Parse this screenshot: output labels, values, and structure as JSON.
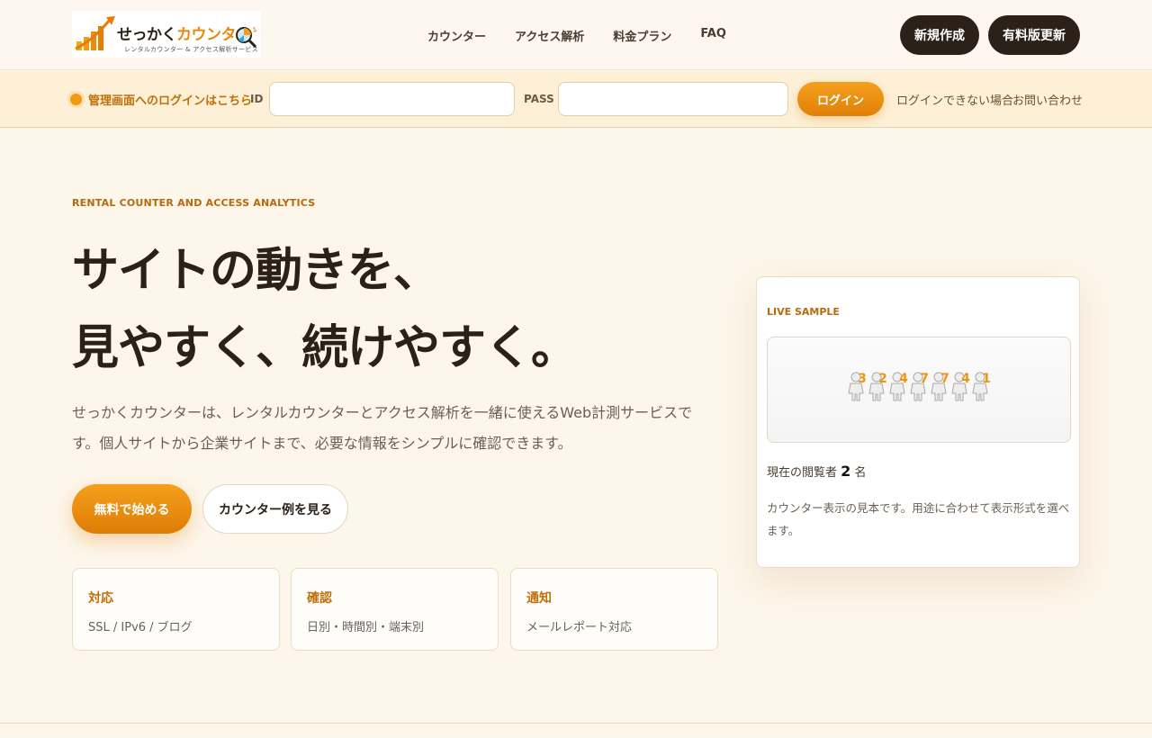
{
  "header": {
    "logo": {
      "main_prefix": "せっかく",
      "main_accent": "カウンター",
      "sub": "レンタルカウンター & アクセス解析サービス"
    },
    "nav": [
      "カウンター",
      "アクセス解析",
      "料金プラン",
      "FAQ"
    ],
    "new_button": "新規作成",
    "paid_button": "有料版更新"
  },
  "login": {
    "label": "管理画面へのログインはこちら",
    "id_label": "ID",
    "pass_label": "PASS",
    "id_value": "",
    "pass_value": "",
    "submit": "ログイン",
    "trouble_link": "ログインできない場合",
    "contact_link": "お問い合わせ"
  },
  "hero": {
    "eyebrow": "RENTAL COUNTER AND ACCESS ANALYTICS",
    "title_line1": "サイトの動きを、",
    "title_line2": "見やすく、続けやすく。",
    "description": "せっかくカウンターは、レンタルカウンターとアクセス解析を一緒に使えるWeb計測サービスです。個人サイトから企業サイトまで、必要な情報をシンプルに確認できます。",
    "cta_primary": "無料で始める",
    "cta_secondary": "カウンター例を見る"
  },
  "features": [
    {
      "title": "対応",
      "desc": "SSL / IPv6 / ブログ"
    },
    {
      "title": "確認",
      "desc": "日別・時間別・端末別"
    },
    {
      "title": "通知",
      "desc": "メールレポート対応"
    }
  ],
  "sample": {
    "eyebrow": "LIVE SAMPLE",
    "digits": [
      "3",
      "2",
      "4",
      "7",
      "7",
      "4",
      "1"
    ],
    "viewers_prefix": "現在の閲覧者",
    "viewers_count": "2",
    "viewers_suffix": "名",
    "note": "カウンター表示の見本です。用途に合わせて表示形式を選べます。"
  },
  "colors": {
    "accent": "#e8890c",
    "dark": "#2b2118",
    "background": "#fdf6ea"
  }
}
